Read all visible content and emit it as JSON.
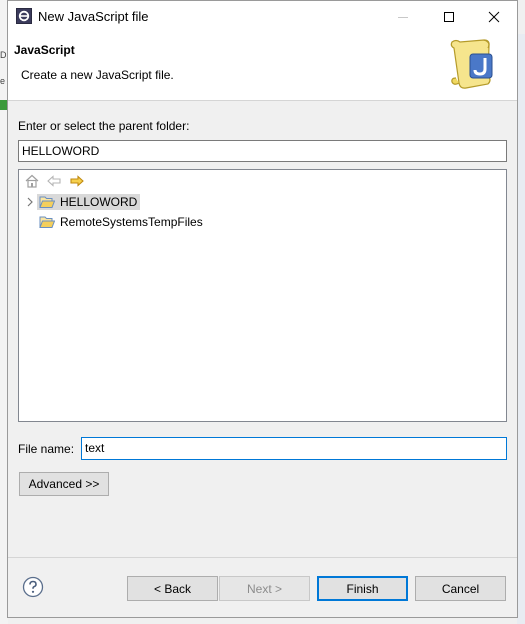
{
  "window": {
    "title": "New JavaScript file"
  },
  "banner": {
    "title": "JavaScript",
    "description": "Create a new JavaScript file."
  },
  "parent_folder": {
    "label": "Enter or select the parent folder:",
    "value": "HELLOWORD"
  },
  "tree": {
    "items": [
      {
        "label": "HELLOWORD",
        "expandable": true,
        "selected": true
      },
      {
        "label": "RemoteSystemsTempFiles",
        "expandable": false,
        "selected": false
      }
    ]
  },
  "file_name": {
    "label": "File name:",
    "value": "text"
  },
  "buttons": {
    "advanced": "Advanced >>",
    "back": "< Back",
    "next": "Next >",
    "finish": "Finish",
    "cancel": "Cancel"
  },
  "colors": {
    "focus": "#0078d7",
    "selection": "#d9d9d9",
    "disabled_text": "#8c8c8c"
  }
}
